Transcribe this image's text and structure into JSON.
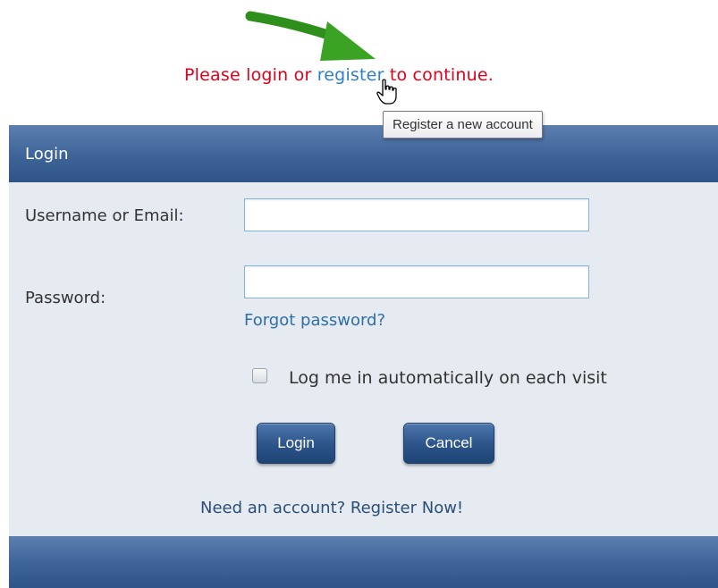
{
  "notice": {
    "prefix": "Please login or ",
    "link": "register",
    "suffix": " to continue."
  },
  "tooltip": {
    "text": "Register a new account"
  },
  "panel": {
    "title": "Login",
    "username_label": "Username or Email:",
    "username_value": "",
    "password_label": "Password:",
    "password_value": "",
    "forgot_link": "Forgot password?",
    "remember_label": "Log me in automatically on each visit",
    "remember_checked": false,
    "login_button": "Login",
    "cancel_button": "Cancel",
    "need_account": "Need an account? Register Now!"
  },
  "icons": {
    "arrow": "green-arrow-icon",
    "cursor": "hand-pointer-icon"
  },
  "colors": {
    "notice_text": "#e0001a",
    "link": "#2f7fc4",
    "header": "#3d6397",
    "panel_bg": "#e6eaf1",
    "arrow": "#3a9a22"
  }
}
